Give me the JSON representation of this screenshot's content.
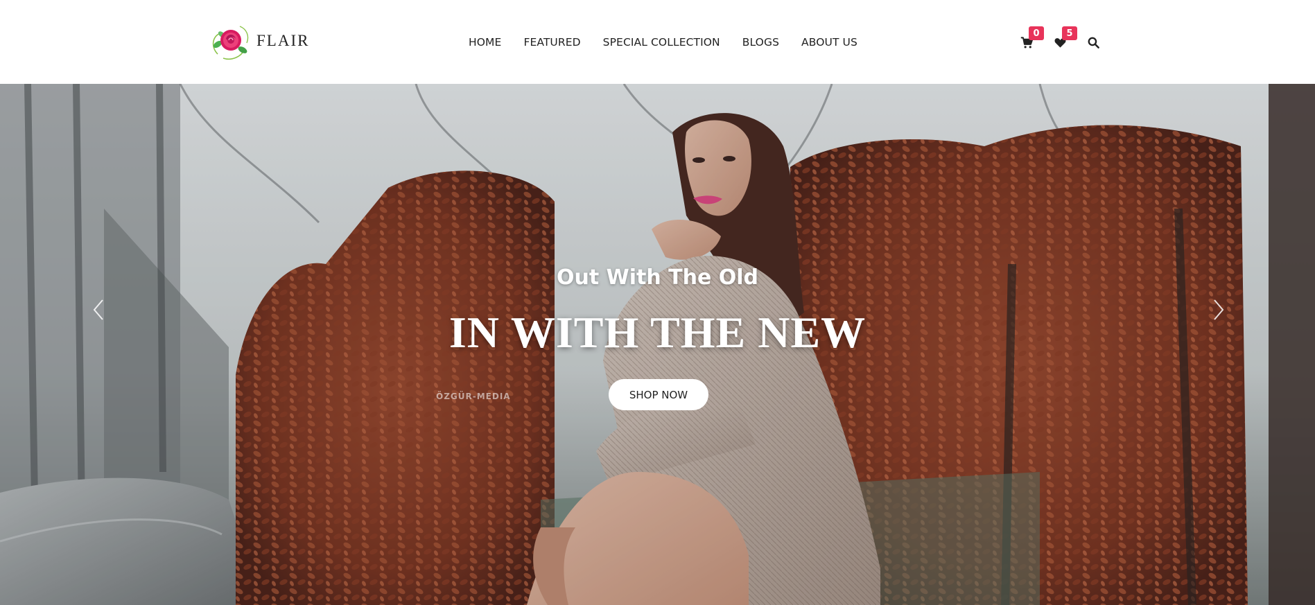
{
  "brand": {
    "name": "FLAIR",
    "logo_icon": "rose-icon"
  },
  "nav": {
    "items": [
      {
        "label": "HOME"
      },
      {
        "label": "FEATURED"
      },
      {
        "label": "SPECIAL COLLECTION"
      },
      {
        "label": "BLOGS"
      },
      {
        "label": "ABOUT US"
      }
    ]
  },
  "header_icons": {
    "cart": {
      "icon": "cart-icon",
      "count": "0"
    },
    "wishlist": {
      "icon": "heart-icon",
      "count": "5"
    },
    "search": {
      "icon": "search-icon"
    }
  },
  "hero": {
    "subtitle": "Out With The Old",
    "title": "IN WITH THE NEW",
    "cta_label": "SHOP NOW",
    "watermark": "ÖZGÜR-MEDIA",
    "prev_icon": "chevron-left-icon",
    "next_icon": "chevron-right-icon"
  },
  "colors": {
    "accent_badge": "#e8345a",
    "header_bg": "#ffffff",
    "nav_text": "#222222",
    "hero_text": "#ffffff",
    "hedge": "#8a3f28"
  }
}
